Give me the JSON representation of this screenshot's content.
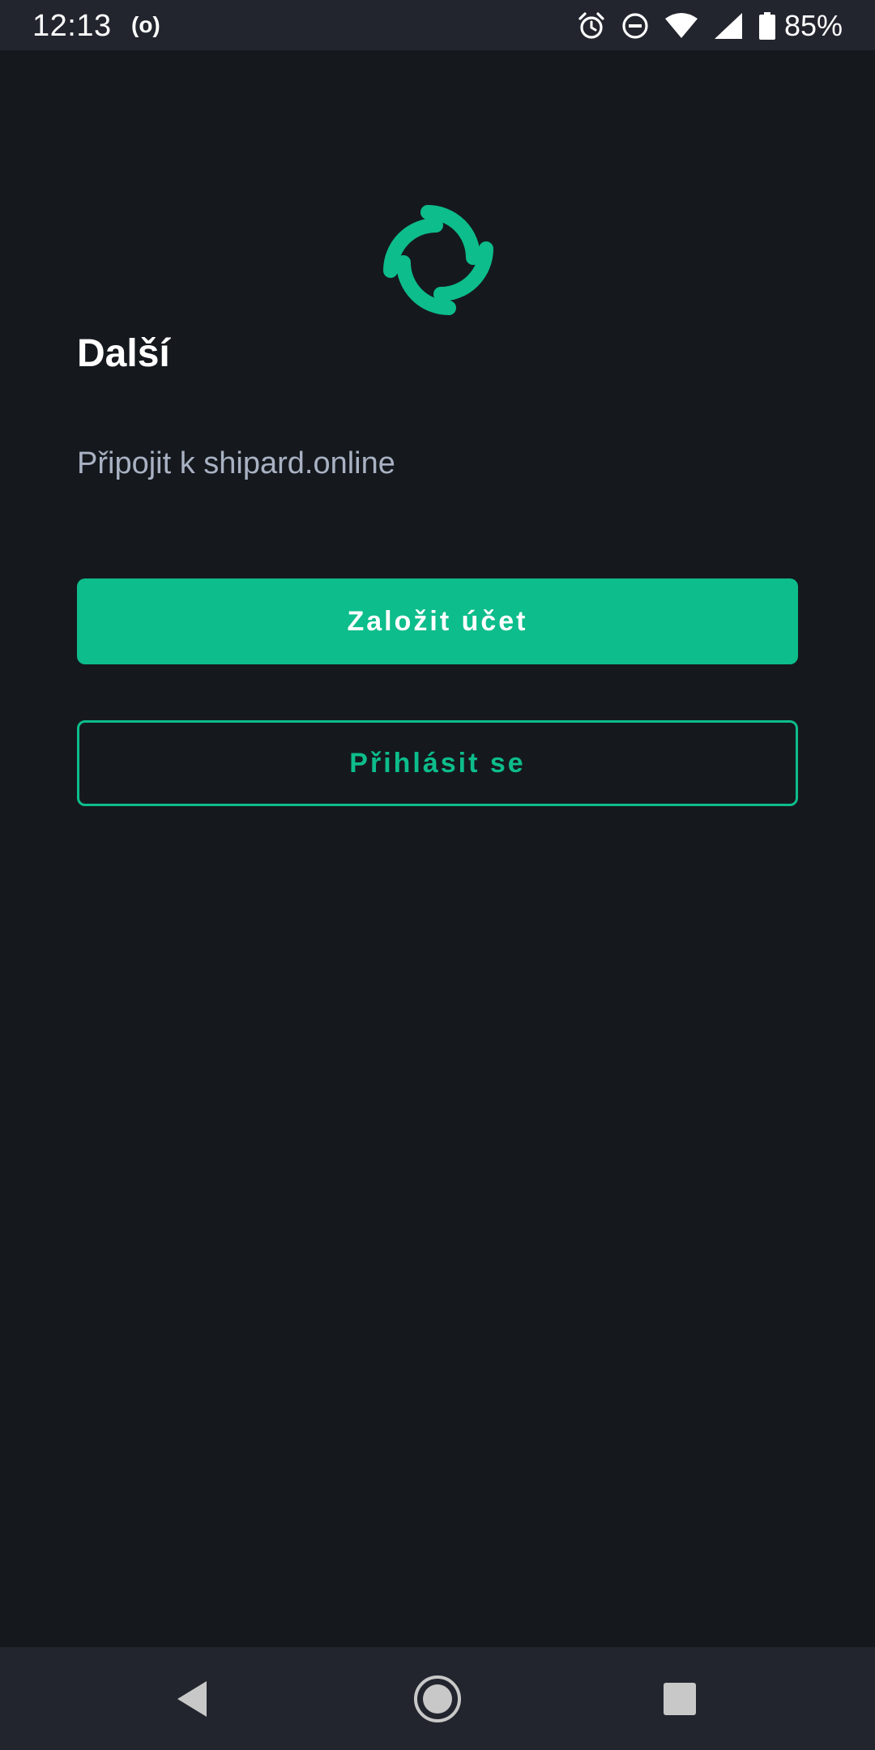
{
  "status_bar": {
    "time": "12:13",
    "hotspot_glyph": "(o)",
    "battery_percent": "85%",
    "icons": [
      "alarm-icon",
      "do-not-disturb-icon",
      "wifi-icon",
      "cell-signal-icon",
      "battery-icon"
    ]
  },
  "main": {
    "logo": "element-logo-icon",
    "title": "Další",
    "subtitle": "Připojit k shipard.online",
    "create_account_label": "Založit účet",
    "sign_in_label": "Přihlásit se"
  },
  "nav_bar": {
    "icons": [
      "back-icon",
      "home-icon",
      "recents-icon"
    ]
  },
  "colors": {
    "background": "#15191e",
    "bars": "#22252e",
    "accent": "#0dbd8b",
    "subtitle_text": "#a9b2c3",
    "title_text": "#ffffff"
  }
}
